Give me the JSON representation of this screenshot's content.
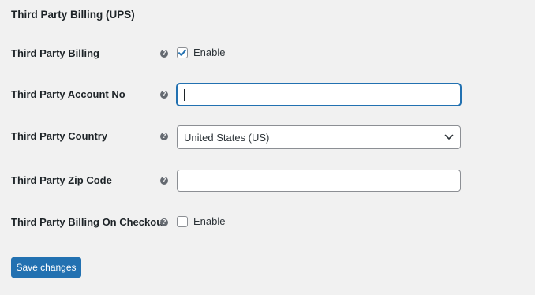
{
  "section_title": "Third Party Billing (UPS)",
  "fields": {
    "billing": {
      "label": "Third Party Billing",
      "checkbox_label": "Enable",
      "checked": true
    },
    "account_no": {
      "label": "Third Party Account No",
      "value": ""
    },
    "country": {
      "label": "Third Party Country",
      "selected": "United States (US)"
    },
    "zip_code": {
      "label": "Third Party Zip Code",
      "value": ""
    },
    "billing_on_checkout": {
      "label": "Third Party Billing On Checkout",
      "checkbox_label": "Enable",
      "checked": false
    }
  },
  "help_glyph": "?",
  "icons": {
    "help": "question-circle-icon",
    "checkmark": "checkmark-icon",
    "dropdown": "chevron-down-icon"
  },
  "colors": {
    "primary": "#2271b1",
    "background": "#f1f1f1",
    "help_icon": "#646970"
  },
  "save_button_label": "Save changes"
}
